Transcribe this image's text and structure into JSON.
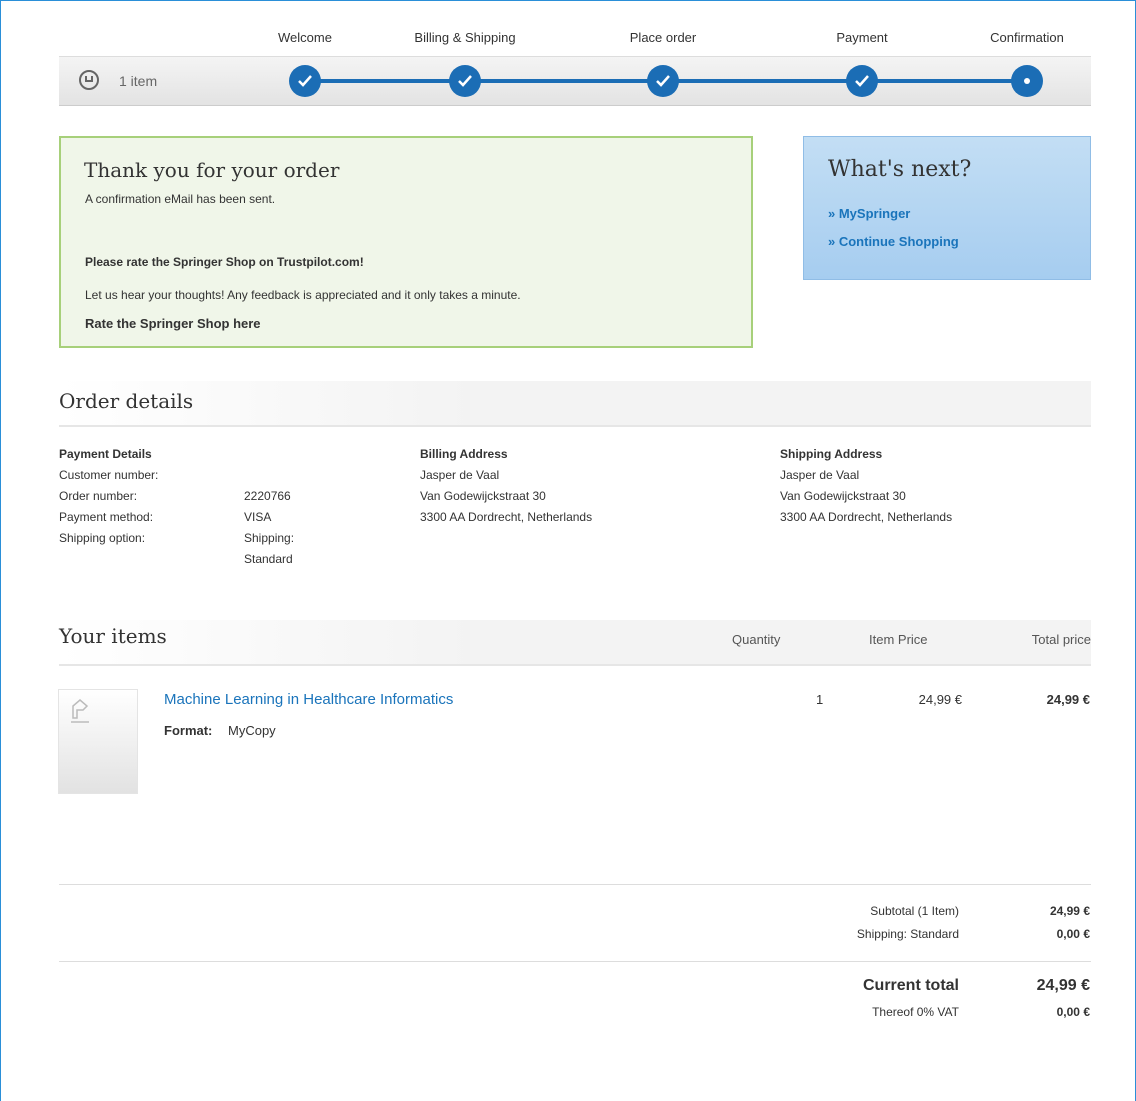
{
  "progress": {
    "steps": [
      "Welcome",
      "Billing & Shipping",
      "Place order",
      "Payment",
      "Confirmation"
    ],
    "cart_count": "1 item"
  },
  "thanks": {
    "title": "Thank you for your order",
    "sent": "A confirmation eMail has been sent.",
    "rate_heading": "Please rate the Springer Shop on Trustpilot.com!",
    "rate_text": "Let us hear your thoughts! Any feedback is appreciated and it only takes a minute.",
    "rate_link": "Rate the Springer Shop here"
  },
  "whats_next": {
    "title": "What's next?",
    "links": [
      "» MySpringer",
      "» Continue Shopping"
    ]
  },
  "order_details": {
    "title": "Order details",
    "payment": {
      "heading": "Payment Details",
      "rows": [
        {
          "label": "Customer number:",
          "value": ""
        },
        {
          "label": "Order number:",
          "value": "2220766"
        },
        {
          "label": "Payment method:",
          "value": "VISA"
        },
        {
          "label": "Shipping option:",
          "value": "Shipping:"
        },
        {
          "label": "",
          "value": "Standard"
        }
      ]
    },
    "billing": {
      "heading": "Billing Address",
      "lines": [
        "Jasper de Vaal",
        "Van Godewijckstraat 30",
        "3300 AA Dordrecht, Netherlands"
      ]
    },
    "shipping": {
      "heading": "Shipping Address",
      "lines": [
        "Jasper de Vaal",
        "Van Godewijckstraat 30",
        "3300 AA Dordrecht, Netherlands"
      ]
    }
  },
  "items": {
    "title": "Your items",
    "col_quantity": "Quantity",
    "col_item_price": "Item Price",
    "col_total_price": "Total price",
    "rows": [
      {
        "title": "Machine Learning in Healthcare Informatics",
        "format_label": "Format:",
        "format_value": "MyCopy",
        "quantity": "1",
        "item_price": "24,99 €",
        "total_price": "24,99 €"
      }
    ]
  },
  "totals": {
    "subtotal_label": "Subtotal (1 Item)",
    "subtotal_value": "24,99 €",
    "shipping_label": "Shipping: Standard",
    "shipping_value": "0,00 €",
    "current_label": "Current total",
    "current_value": "24,99 €",
    "vat_label": "Thereof 0% VAT",
    "vat_value": "0,00 €"
  },
  "colors": {
    "accent": "#1b6db5",
    "link": "#1a74bb",
    "success_bg": "#f0f6e9",
    "success_border": "#a7d07a",
    "info_bg": "#b5d7f3"
  }
}
